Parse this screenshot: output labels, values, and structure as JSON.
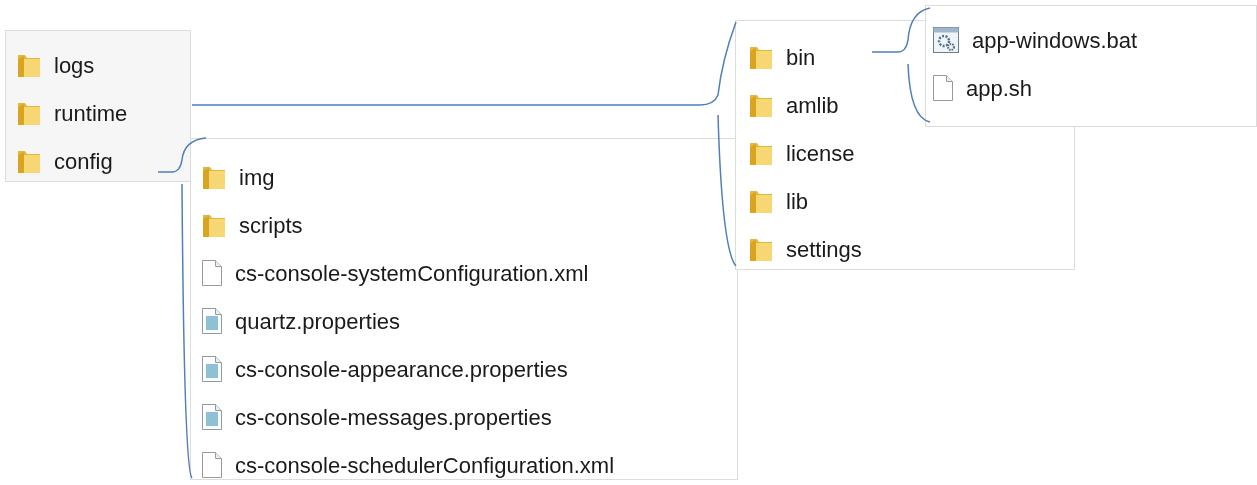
{
  "panels": [
    {
      "items": [
        {
          "name": "logs",
          "kind": "folder"
        },
        {
          "name": "runtime",
          "kind": "folder"
        },
        {
          "name": "config",
          "kind": "folder"
        }
      ]
    },
    {
      "items": [
        {
          "name": "img",
          "kind": "folder"
        },
        {
          "name": "scripts",
          "kind": "folder"
        },
        {
          "name": "cs-console-systemConfiguration.xml",
          "kind": "file"
        },
        {
          "name": "quartz.properties",
          "kind": "properties"
        },
        {
          "name": "cs-console-appearance.properties",
          "kind": "properties"
        },
        {
          "name": "cs-console-messages.properties",
          "kind": "properties"
        },
        {
          "name": "cs-console-schedulerConfiguration.xml",
          "kind": "file"
        }
      ]
    },
    {
      "items": [
        {
          "name": "bin",
          "kind": "folder"
        },
        {
          "name": "amlib",
          "kind": "folder"
        },
        {
          "name": "license",
          "kind": "folder"
        },
        {
          "name": "lib",
          "kind": "folder"
        },
        {
          "name": "settings",
          "kind": "folder"
        }
      ]
    },
    {
      "items": [
        {
          "name": "app-windows.bat",
          "kind": "batch"
        },
        {
          "name": "app.sh",
          "kind": "file"
        }
      ]
    }
  ]
}
